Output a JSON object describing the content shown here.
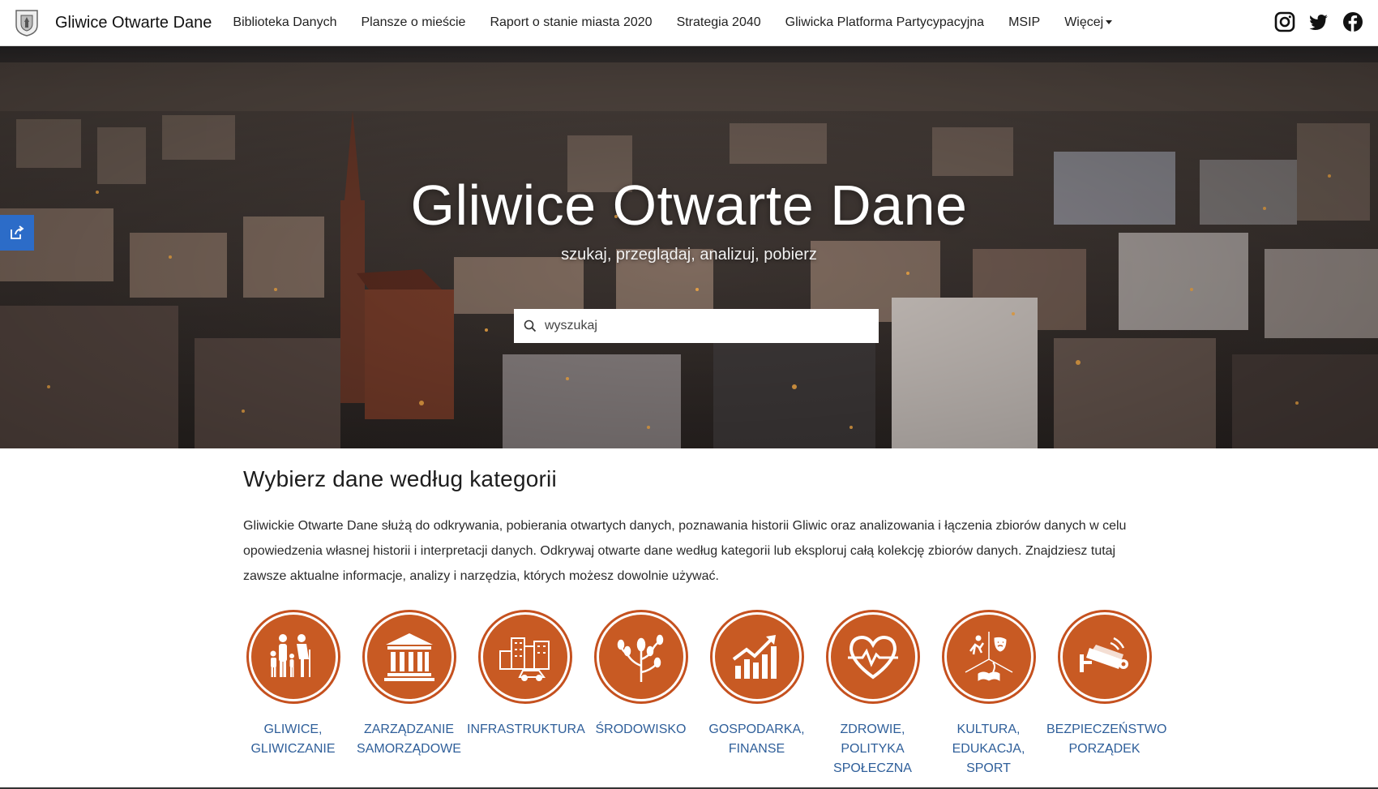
{
  "nav": {
    "title": "Gliwice Otwarte Dane",
    "links": [
      "Biblioteka Danych",
      "Plansze o mieście",
      "Raport o stanie miasta 2020",
      "Strategia 2040",
      "Gliwicka Platforma Partycypacyjna",
      "MSIP",
      "Więcej"
    ],
    "social_icons": [
      "instagram-icon",
      "twitter-icon",
      "facebook-icon"
    ]
  },
  "hero": {
    "title": "Gliwice Otwarte Dane",
    "subtitle": "szukaj, przeglądaj, analizuj, pobierz",
    "search_placeholder": "wyszukaj"
  },
  "section": {
    "title": "Wybierz dane według kategorii",
    "intro": "Gliwickie Otwarte Dane służą do odkrywania, pobierania otwartych danych, poznawania historii Gliwic oraz analizowania i łączenia zbiorów danych w celu opowiedzenia własnej historii i interpretacji danych. Odkrywaj otwarte dane według kategorii lub eksploruj całą kolekcję zbiorów danych. Znajdziesz tutaj zawsze aktualne informacje, analizy i narzędzia, których możesz dowolnie używać."
  },
  "categories": [
    {
      "label": "GLIWICE, GLIWICZANIE",
      "icon": "family-icon"
    },
    {
      "label": "ZARZĄDZANIE SAMORZĄDOWE",
      "icon": "government-building-icon"
    },
    {
      "label": "INFRASTRUKTURA",
      "icon": "city-car-icon"
    },
    {
      "label": "ŚRODOWISKO",
      "icon": "tree-icon"
    },
    {
      "label": "GOSPODARKA, FINANSE",
      "icon": "growth-chart-icon"
    },
    {
      "label": "ZDROWIE, POLITYKA SPOŁECZNA",
      "icon": "heart-pulse-icon"
    },
    {
      "label": "KULTURA, EDUKACJA, SPORT",
      "icon": "culture-sport-icon"
    },
    {
      "label": "BEZPIECZEŃSTWO PORZĄDEK",
      "icon": "cctv-camera-icon"
    }
  ],
  "colors": {
    "accent": "#c85a23",
    "link": "#2f5f9a",
    "side_tab": "#2c6cc8"
  }
}
